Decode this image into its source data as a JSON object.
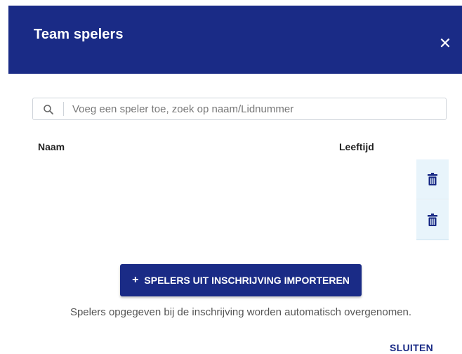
{
  "dialog": {
    "title": "Team spelers",
    "close_icon": "close-icon",
    "close_symbol": "✕"
  },
  "search": {
    "placeholder": "Voeg een speler toe, zoek op naam/Lidnummer",
    "value": ""
  },
  "table": {
    "columns": [
      "Naam",
      "Leeftijd"
    ],
    "rows": [
      {
        "name": "",
        "age": "",
        "action_icon": "trash-icon"
      },
      {
        "name": "",
        "age": "",
        "action_icon": "trash-icon"
      }
    ]
  },
  "import_button": {
    "icon": "plus-icon",
    "plus": "+",
    "label": "SPELERS UIT INSCHRIJVING IMPORTEREN"
  },
  "info_text": "Spelers opgegeven bij de inschrijving worden automatisch overgenomen.",
  "footer": {
    "close_label": "SLUITEN"
  },
  "colors": {
    "primary": "#1a2b86",
    "row_action_bg": "#e8f4fb"
  }
}
